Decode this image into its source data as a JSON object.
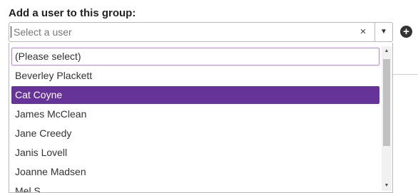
{
  "form": {
    "heading": "Add a user to this group:",
    "select_placeholder": "Select a user",
    "clear_symbol": "×",
    "arrow_symbol": "▼",
    "add_symbol": "+"
  },
  "dropdown": {
    "focused_index": 0,
    "selected_value": "Cat Coyne",
    "options": [
      "(Please select)",
      "Beverley Plackett",
      "Cat Coyne",
      "James McClean",
      "Jane Creedy",
      "Janis Lovell",
      "Joanne Madsen",
      "Mel S"
    ],
    "scroll_up_symbol": "▲",
    "scroll_down_symbol": "▼"
  },
  "colors": {
    "highlight": "#663399",
    "focus_border": "#b98fe0"
  },
  "icons": {
    "clear": "close-icon",
    "dropdown": "chevron-down-icon",
    "add": "plus-circle-icon"
  }
}
